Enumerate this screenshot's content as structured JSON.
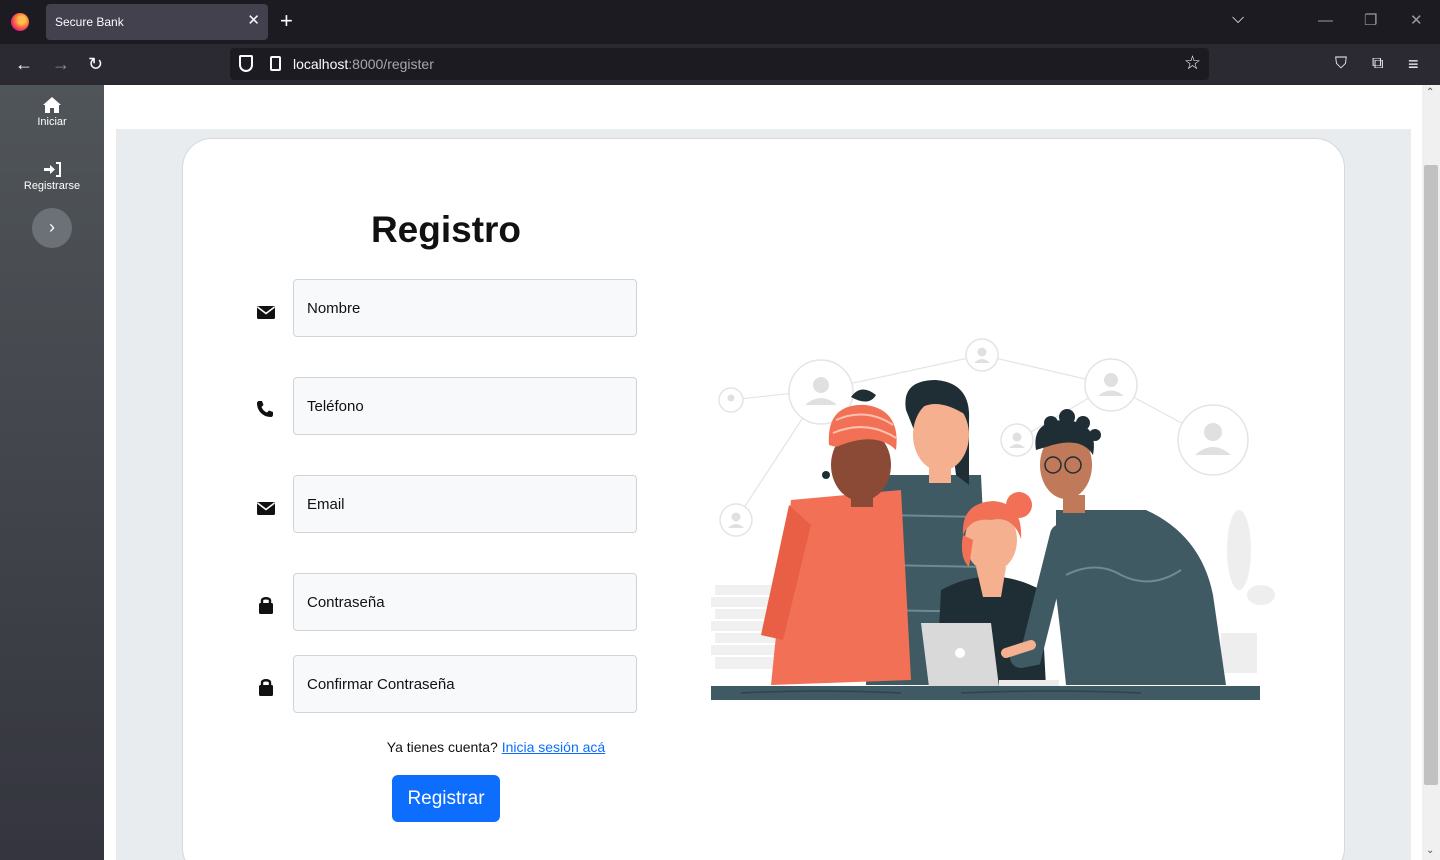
{
  "browser": {
    "tab_title": "Secure Bank",
    "tab_close": "✕",
    "new_tab": "+",
    "url_host": "localhost",
    "url_rest": ":8000/register"
  },
  "sidebar": {
    "items": [
      {
        "label": "Iniciar",
        "icon": "home-icon"
      },
      {
        "label": "Registrarse",
        "icon": "sign-in-icon"
      }
    ],
    "toggle_glyph": "›"
  },
  "form": {
    "title": "Registro",
    "fields": [
      {
        "placeholder": "Nombre",
        "icon": "envelope-icon"
      },
      {
        "placeholder": "Teléfono",
        "icon": "phone-icon"
      },
      {
        "placeholder": "Email",
        "icon": "envelope-icon"
      },
      {
        "placeholder": "Contraseña",
        "icon": "lock-icon"
      },
      {
        "placeholder": "Confirmar Contraseña",
        "icon": "lock-icon"
      }
    ],
    "login_prompt": "Ya tienes cuenta?",
    "login_link": "Inicia sesión acá",
    "submit_label": "Registrar"
  },
  "colors": {
    "primary": "#0d6efd",
    "sidebar_top": "#505559",
    "sidebar_bottom": "#34353e",
    "illustration_orange": "#f27156",
    "illustration_teal": "#3f5a63"
  }
}
